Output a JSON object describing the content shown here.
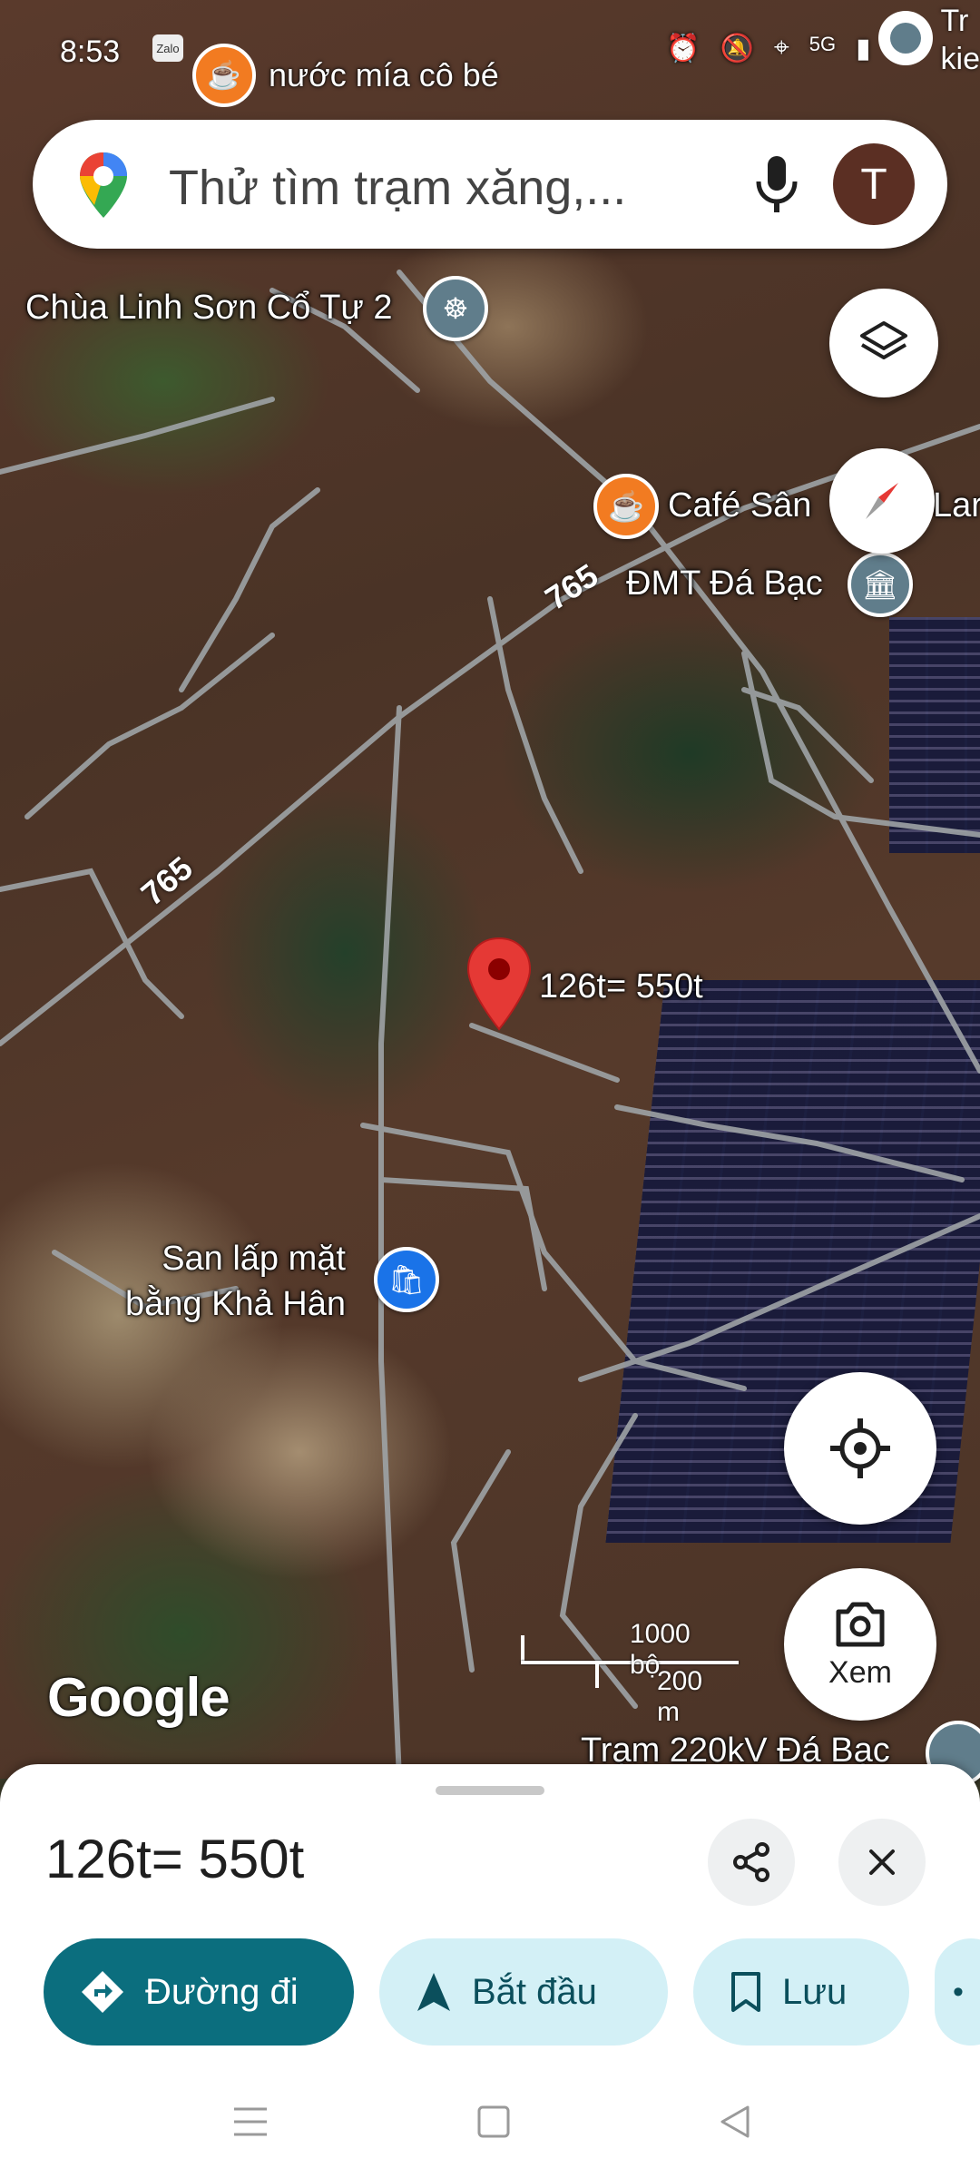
{
  "status_bar": {
    "time": "8:53",
    "zalo_label": "Zalo",
    "network": "5G"
  },
  "top_nav": {
    "destination_label": "nước mía cô bé",
    "corner_text_line1": "Tr",
    "corner_text_line2": "kie"
  },
  "search": {
    "placeholder": "Thử tìm trạm xăng,...",
    "avatar_letter": "T"
  },
  "map": {
    "labels": {
      "pagoda": "Chùa Linh Sơn Cổ Tự 2",
      "cafe": "Café Sân",
      "cafe_suffix": "Lar",
      "dmt": "ĐMT Đá Bạc",
      "pin": "126t= 550t",
      "san_lap_line1": "San lấp mặt",
      "san_lap_line2": "bằng Khả Hân",
      "substation": "Trạm 220kV Đá Bạc"
    },
    "road_numbers": [
      "765",
      "765"
    ],
    "scale": {
      "imperial": "1000 bộ",
      "metric": "200 m"
    },
    "attribution": "Google",
    "view_button_label": "Xem"
  },
  "sheet": {
    "title": "126t= 550t",
    "actions": [
      {
        "label": "Đường đi"
      },
      {
        "label": "Bắt đầu"
      },
      {
        "label": "Lưu"
      }
    ]
  },
  "colors": {
    "primary": "#0b6e7e",
    "secondary_bg": "#d3f0f6",
    "pin_red": "#e53935",
    "orange": "#f27b21"
  }
}
